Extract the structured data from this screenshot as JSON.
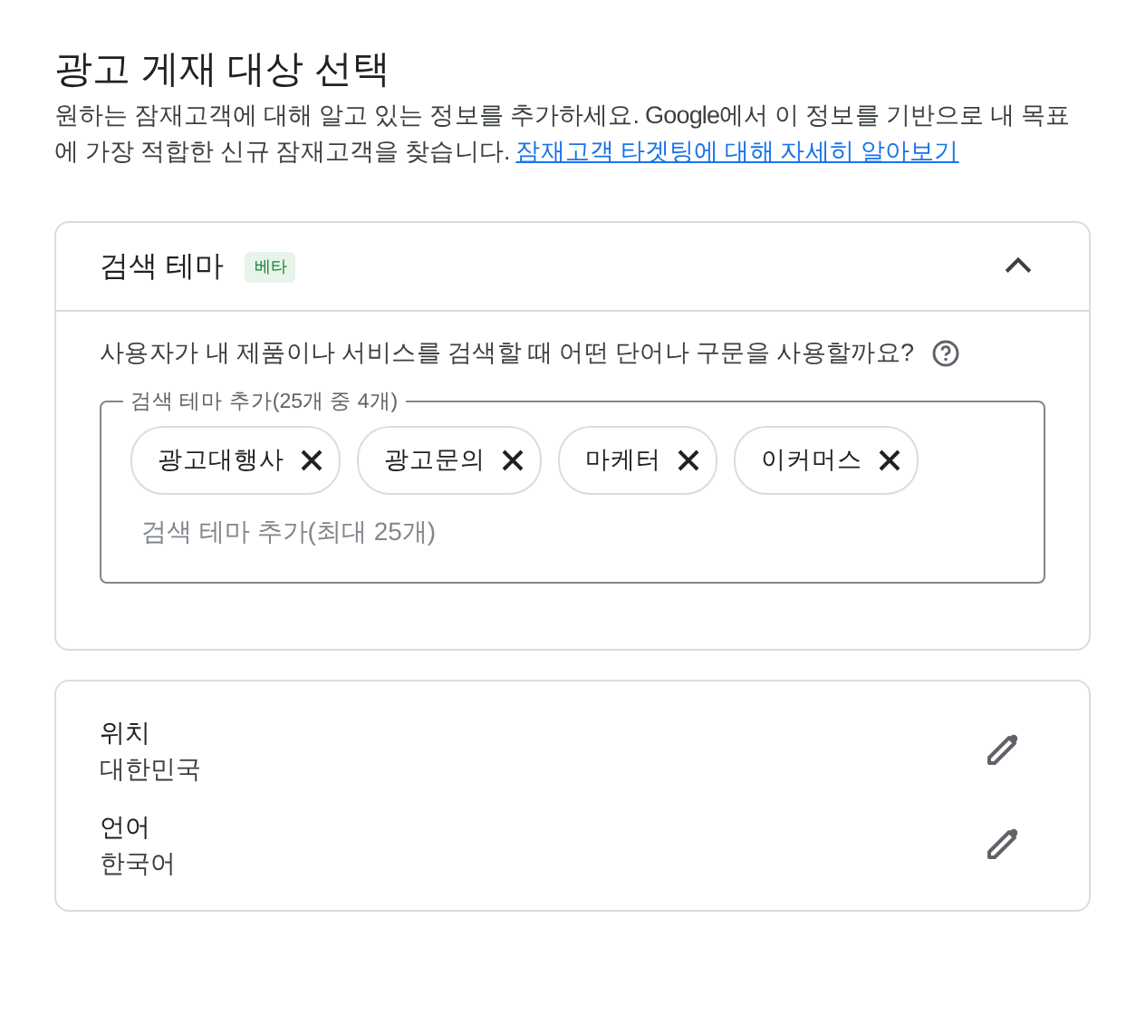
{
  "title": "광고 게재 대상 선택",
  "description": "원하는 잠재고객에 대해 알고 있는 정보를 추가하세요. Google에서 이 정보를 기반으로 내 목표에 가장 적합한 신규 잠재고객을 찾습니다.",
  "learn_more_link": "잠재고객 타겟팅에 대해 자세히 알아보기",
  "search_themes": {
    "title": "검색 테마",
    "badge": "베타",
    "expanded": true,
    "question": "사용자가 내 제품이나 서비스를 검색할 때 어떤 단어나 구문을 사용할까요?",
    "field_label": "검색 테마 추가(25개 중 4개)",
    "chips": [
      {
        "label": "광고대행사"
      },
      {
        "label": "광고문의"
      },
      {
        "label": "마케터"
      },
      {
        "label": "이커머스"
      }
    ],
    "placeholder": "검색 테마 추가(최대 25개)"
  },
  "settings": [
    {
      "label": "위치",
      "value": "대한민국"
    },
    {
      "label": "언어",
      "value": "한국어"
    }
  ]
}
